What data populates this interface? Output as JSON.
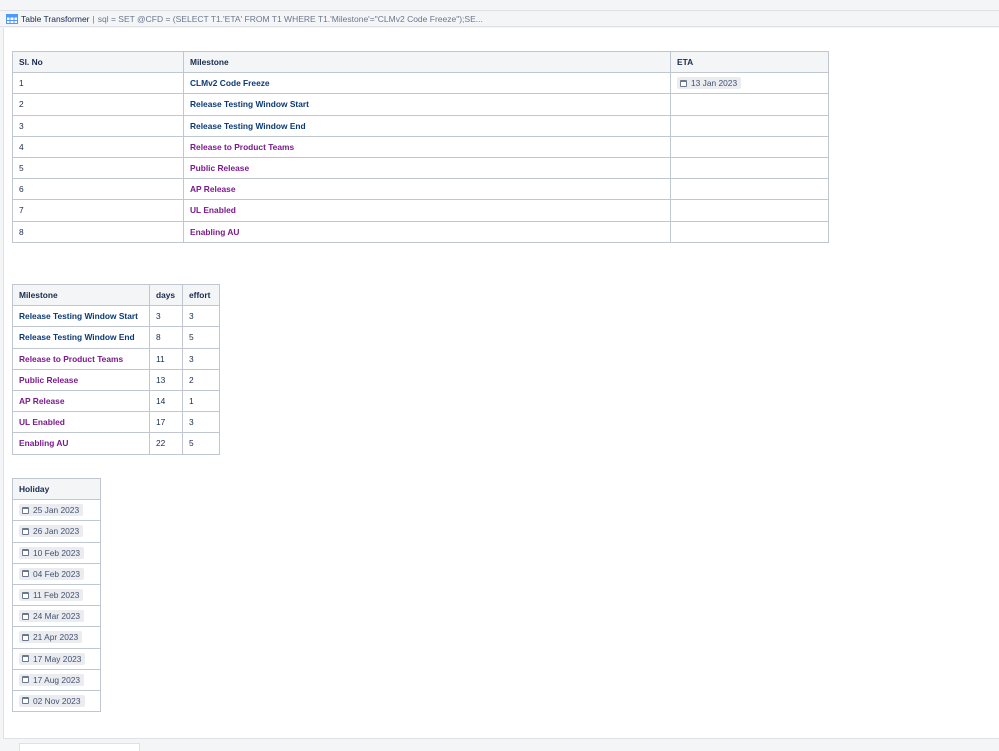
{
  "macro": {
    "title": "Table Transformer",
    "separator": "|",
    "query": "sql = SET @CFD = (SELECT T1.'ETA' FROM T1 WHERE T1.'Milestone'=\"CLMv2 Code Freeze\");SE..."
  },
  "icons": {
    "macro_icon": "table-transformer-icon",
    "date_icon": "calendar-icon"
  },
  "colors": {
    "milestone_blue": "#0a3a75",
    "milestone_purple": "#7a1a8c",
    "header_bg": "#f4f5f7",
    "border": "#c1c7d0"
  },
  "milestones_table": {
    "headers": [
      "Sl. No",
      "Milestone",
      "ETA"
    ],
    "rows": [
      {
        "sl": "1",
        "milestone": "CLMv2 Code Freeze",
        "eta": "13 Jan 2023"
      },
      {
        "sl": "2",
        "milestone": "Release Testing Window Start",
        "eta": ""
      },
      {
        "sl": "3",
        "milestone": "Release Testing Window End",
        "eta": ""
      },
      {
        "sl": "4",
        "milestone": "Release to Product Teams",
        "eta": ""
      },
      {
        "sl": "5",
        "milestone": "Public Release",
        "eta": ""
      },
      {
        "sl": "6",
        "milestone": "AP Release",
        "eta": ""
      },
      {
        "sl": "7",
        "milestone": "UL Enabled",
        "eta": ""
      },
      {
        "sl": "8",
        "milestone": "Enabling AU",
        "eta": ""
      }
    ]
  },
  "days_table": {
    "headers": [
      "Milestone",
      "days",
      "effort"
    ],
    "rows": [
      {
        "milestone": "Release Testing Window Start",
        "days": "3",
        "effort": "3"
      },
      {
        "milestone": "Release Testing Window End",
        "days": "8",
        "effort": "5"
      },
      {
        "milestone": "Release to Product Teams",
        "days": "11",
        "effort": "3"
      },
      {
        "milestone": "Public Release",
        "days": "13",
        "effort": "2"
      },
      {
        "milestone": "AP Release",
        "days": "14",
        "effort": "1"
      },
      {
        "milestone": "UL Enabled",
        "days": "17",
        "effort": "3"
      },
      {
        "milestone": "Enabling AU",
        "days": "22",
        "effort": "5"
      }
    ]
  },
  "holidays_table": {
    "headers": [
      "Holiday"
    ],
    "rows": [
      {
        "date": "25 Jan 2023"
      },
      {
        "date": "26 Jan 2023"
      },
      {
        "date": "10 Feb 2023"
      },
      {
        "date": "04 Feb 2023"
      },
      {
        "date": "11 Feb 2023"
      },
      {
        "date": "24 Mar 2023"
      },
      {
        "date": "21 Apr 2023"
      },
      {
        "date": "17 May 2023"
      },
      {
        "date": "17 Aug 2023"
      },
      {
        "date": "02 Nov 2023"
      }
    ]
  }
}
